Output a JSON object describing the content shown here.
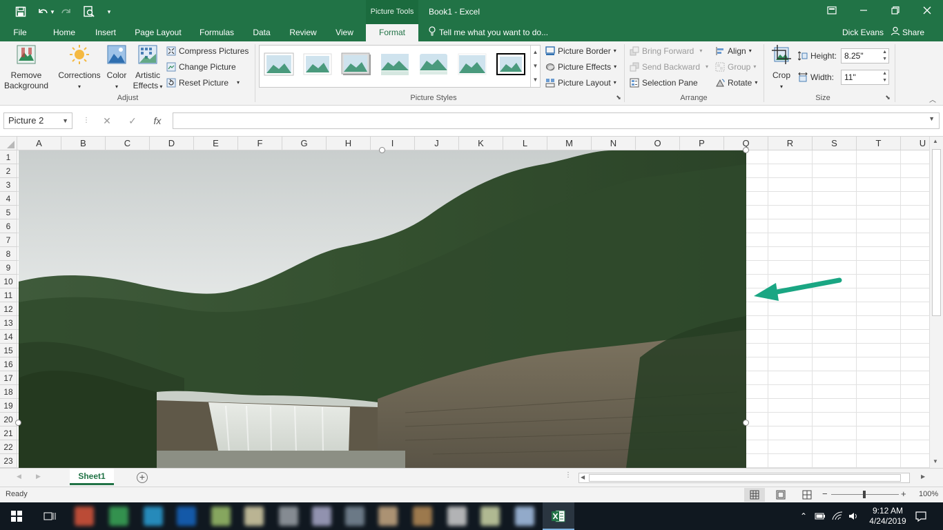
{
  "window": {
    "title": "Book1 - Excel",
    "context_tab": "Picture Tools"
  },
  "quick_access": {
    "save": "save",
    "undo": "undo",
    "redo": "redo",
    "preview": "print-preview",
    "customize": "customize"
  },
  "tabs": [
    {
      "label": "File",
      "active": false
    },
    {
      "label": "Home",
      "active": false
    },
    {
      "label": "Insert",
      "active": false
    },
    {
      "label": "Page Layout",
      "active": false
    },
    {
      "label": "Formulas",
      "active": false
    },
    {
      "label": "Data",
      "active": false
    },
    {
      "label": "Review",
      "active": false
    },
    {
      "label": "View",
      "active": false
    },
    {
      "label": "Format",
      "active": true
    }
  ],
  "tell_me": "Tell me what you want to do...",
  "user": {
    "name": "Dick Evans",
    "share": "Share"
  },
  "ribbon": {
    "adjust": {
      "remove_background_line1": "Remove",
      "remove_background_line2": "Background",
      "corrections": "Corrections",
      "color": "Color",
      "artistic_line1": "Artistic",
      "artistic_line2": "Effects",
      "compress": "Compress Pictures",
      "change": "Change Picture",
      "reset": "Reset Picture",
      "label": "Adjust"
    },
    "picture_styles": {
      "label": "Picture Styles",
      "border": "Picture Border",
      "effects": "Picture Effects",
      "layout": "Picture Layout"
    },
    "arrange": {
      "label": "Arrange",
      "bring_forward": "Bring Forward",
      "send_backward": "Send Backward",
      "selection_pane": "Selection Pane",
      "align": "Align",
      "group": "Group",
      "rotate": "Rotate"
    },
    "size": {
      "label": "Size",
      "crop": "Crop",
      "height_label": "Height:",
      "height_value": "8.25\"",
      "width_label": "Width:",
      "width_value": "11\""
    }
  },
  "formula_bar": {
    "name_box": "Picture 2",
    "fx": "fx"
  },
  "columns": [
    "A",
    "B",
    "C",
    "D",
    "E",
    "F",
    "G",
    "H",
    "I",
    "J",
    "K",
    "L",
    "M",
    "N",
    "O",
    "P",
    "Q",
    "R",
    "S",
    "T",
    "U"
  ],
  "rows": [
    "1",
    "2",
    "3",
    "4",
    "5",
    "6",
    "7",
    "8",
    "9",
    "10",
    "11",
    "12",
    "13",
    "14",
    "15",
    "16",
    "17",
    "18",
    "19",
    "20",
    "21",
    "22",
    "23"
  ],
  "sheet": {
    "tab": "Sheet1"
  },
  "status": {
    "ready": "Ready",
    "zoom": "100%"
  },
  "taskbar": {
    "time": "9:12 AM",
    "date": "4/24/2019"
  },
  "colors": {
    "accent": "#217346",
    "arrow": "#1aa683"
  }
}
